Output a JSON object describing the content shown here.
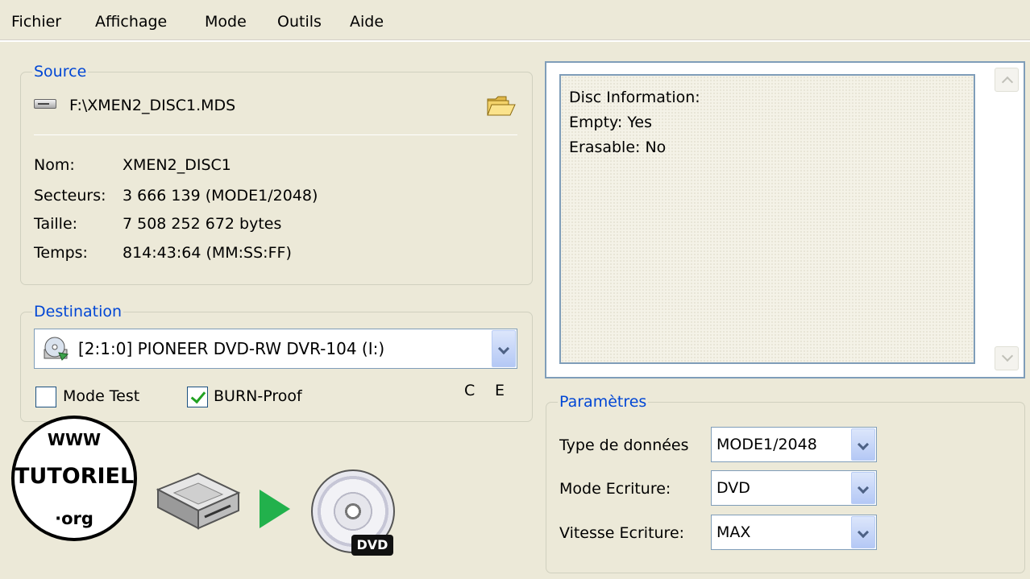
{
  "menu": [
    "Fichier",
    "Affichage",
    "Mode",
    "Outils",
    "Aide"
  ],
  "source": {
    "legend": "Source",
    "path": "F:\\XMEN2_DISC1.MDS",
    "fields": [
      {
        "label": "Nom:",
        "value": "XMEN2_DISC1"
      },
      {
        "label": "Secteurs:",
        "value": "3 666 139 (MODE1/2048)"
      },
      {
        "label": "Taille:",
        "value": "7 508 252 672 bytes"
      },
      {
        "label": "Temps:",
        "value": "814:43:64 (MM:SS:FF)"
      }
    ]
  },
  "destination": {
    "legend": "Destination",
    "drive": "[2:1:0] PIONEER DVD-RW  DVR-104 (I:)",
    "mode_test_label": "Mode Test",
    "mode_test_checked": false,
    "burn_proof_label": "BURN-Proof",
    "burn_proof_checked": true,
    "flag_c": "C",
    "flag_e": "E"
  },
  "disc_info": {
    "lines": [
      "Disc Information:",
      "Empty: Yes",
      "Erasable: No"
    ]
  },
  "parametres": {
    "legend": "Paramètres",
    "fields": [
      {
        "label": "Type de données",
        "value": "MODE1/2048"
      },
      {
        "label": "Mode Ecriture:",
        "value": "DVD"
      },
      {
        "label": "Vitesse Ecriture:",
        "value": "MAX"
      }
    ]
  },
  "watermark": {
    "top": "WWW",
    "middle": "TUTORIEL",
    "bottom": "·org"
  },
  "dvd_badge": "DVD",
  "icons": {
    "source_drive": "hard-drive-icon",
    "browse": "open-folder-icon",
    "dest_drive": "optical-drive-icon",
    "burn_from": "hard-drive-icon",
    "burn_arrow": "play-icon",
    "burn_to": "dvd-disc-icon"
  }
}
